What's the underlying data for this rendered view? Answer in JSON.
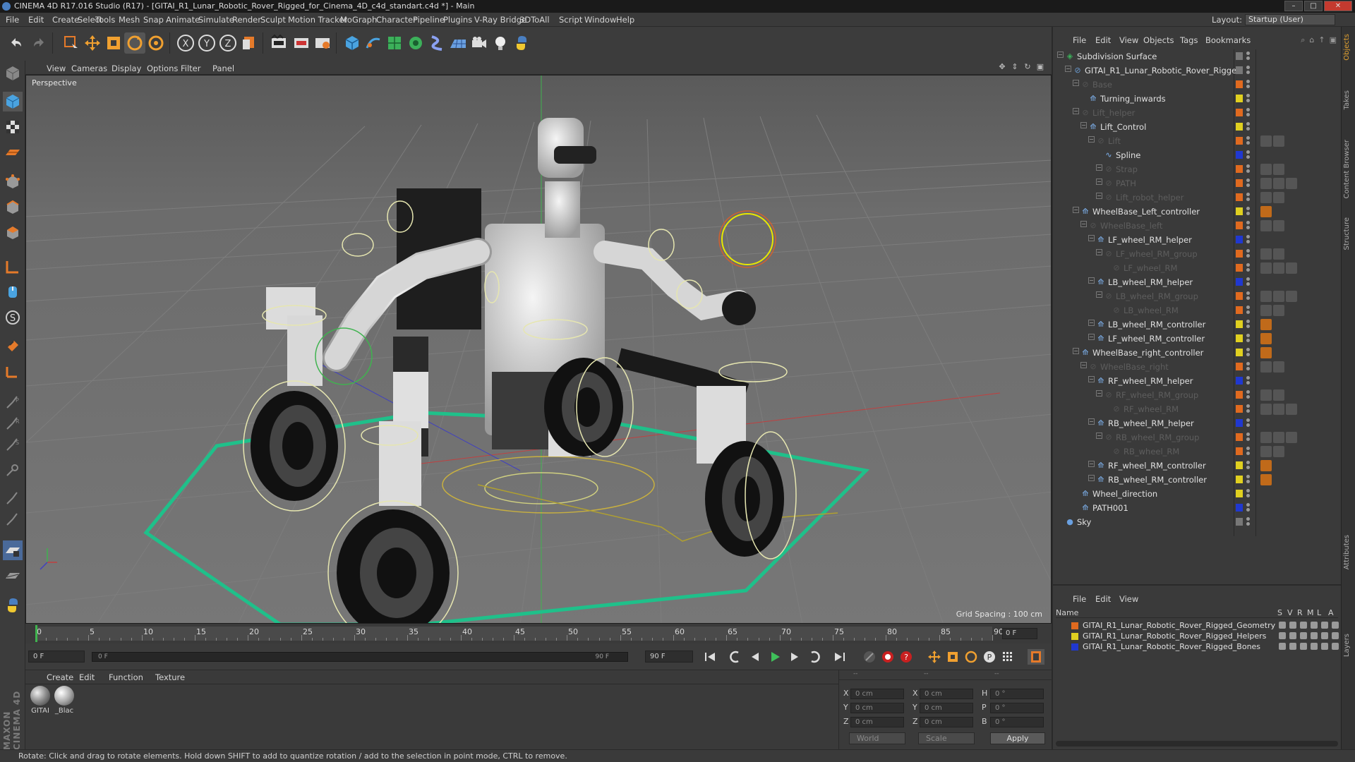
{
  "window": {
    "title": "CINEMA 4D R17.016 Studio (R17) - [GITAI_R1_Lunar_Robotic_Rover_Rigged_for_Cinema_4D_c4d_standart.c4d *] - Main"
  },
  "menu": [
    "File",
    "Edit",
    "Create",
    "Select",
    "Tools",
    "Mesh",
    "Snap",
    "Animate",
    "Simulate",
    "Render",
    "Sculpt",
    "Motion Tracker",
    "MoGraph",
    "Character",
    "Pipeline",
    "Plugins",
    "V-Ray Bridge",
    "3DToAll",
    "Script",
    "Window",
    "Help"
  ],
  "layout": {
    "label": "Layout:",
    "value": "Startup (User)"
  },
  "viewport": {
    "menu": [
      "View",
      "Cameras",
      "Display",
      "Options",
      "Filter",
      "Panel"
    ],
    "label": "Perspective",
    "grid_spacing": "Grid Spacing : 100 cm"
  },
  "timeline": {
    "ticks": [
      "0",
      "5",
      "10",
      "15",
      "20",
      "25",
      "30",
      "35",
      "40",
      "45",
      "50",
      "55",
      "60",
      "65",
      "70",
      "75",
      "80",
      "85",
      "90"
    ],
    "current_frame": "0 F",
    "start": "0 F",
    "slider_start": "0 F",
    "slider_end": "90 F",
    "end": "90 F"
  },
  "material_manager": {
    "menu": [
      "Create",
      "Edit",
      "Function",
      "Texture"
    ],
    "materials": [
      {
        "label": "GITAI",
        "color": "#9a9a9a"
      },
      {
        "label": "_Blac",
        "color": "#b0b0b0"
      }
    ]
  },
  "coords": {
    "header": [
      "--",
      "--",
      "--"
    ],
    "rows": [
      {
        "a": "X",
        "av": "0 cm",
        "b": "X",
        "bv": "0 cm",
        "c": "H",
        "cv": "0 °"
      },
      {
        "a": "Y",
        "av": "0 cm",
        "b": "Y",
        "bv": "0 cm",
        "c": "P",
        "cv": "0 °"
      },
      {
        "a": "Z",
        "av": "0 cm",
        "b": "Z",
        "bv": "0 cm",
        "c": "B",
        "cv": "0 °"
      }
    ],
    "world": "World",
    "scale": "Scale",
    "apply": "Apply"
  },
  "object_manager": {
    "menu": [
      "File",
      "Edit",
      "View",
      "Objects",
      "Tags",
      "Bookmarks"
    ],
    "objects": [
      {
        "name": "Subdivision Surface",
        "depth": 0,
        "dim": false,
        "tag": "#777",
        "icon": "subdivision-icon"
      },
      {
        "name": "GITAI_R1_Lunar_Robotic_Rover_Rigged",
        "depth": 1,
        "dim": false,
        "tag": "#777",
        "icon": "null-icon"
      },
      {
        "name": "Base",
        "depth": 2,
        "dim": true,
        "tag": "#e06a1f",
        "icon": "null-icon"
      },
      {
        "name": "Turning_inwards",
        "depth": 3,
        "dim": false,
        "tag": "#e0d020",
        "icon": "joint-icon"
      },
      {
        "name": "Lift_helper",
        "depth": 2,
        "dim": true,
        "tag": "#e06a1f",
        "icon": "null-icon"
      },
      {
        "name": "Lift_Control",
        "depth": 3,
        "dim": false,
        "tag": "#e0d020",
        "icon": "joint-icon"
      },
      {
        "name": "Lift",
        "depth": 4,
        "dim": true,
        "tag": "#e06a1f",
        "icon": "null-icon"
      },
      {
        "name": "Spline",
        "depth": 5,
        "dim": false,
        "tag": "#2038d0",
        "icon": "spline-icon"
      },
      {
        "name": "Strap",
        "depth": 5,
        "dim": true,
        "tag": "#e06a1f",
        "icon": "null-icon"
      },
      {
        "name": "PATH",
        "depth": 5,
        "dim": true,
        "tag": "#e06a1f",
        "icon": "null-icon"
      },
      {
        "name": "Lift_robot_helper",
        "depth": 5,
        "dim": true,
        "tag": "#e06a1f",
        "icon": "null-icon"
      },
      {
        "name": "WheelBase_Left_controller",
        "depth": 2,
        "dim": false,
        "tag": "#e0d020",
        "icon": "joint-icon"
      },
      {
        "name": "WheelBase_left",
        "depth": 3,
        "dim": true,
        "tag": "#e06a1f",
        "icon": "null-icon"
      },
      {
        "name": "LF_wheel_RM_helper",
        "depth": 4,
        "dim": false,
        "tag": "#2038d0",
        "icon": "joint-icon"
      },
      {
        "name": "LF_wheel_RM_group",
        "depth": 5,
        "dim": true,
        "tag": "#e06a1f",
        "icon": "null-icon"
      },
      {
        "name": "LF_wheel_RM",
        "depth": 6,
        "dim": true,
        "tag": "#e06a1f",
        "icon": "null-icon"
      },
      {
        "name": "LB_wheel_RM_helper",
        "depth": 4,
        "dim": false,
        "tag": "#2038d0",
        "icon": "joint-icon"
      },
      {
        "name": "LB_wheel_RM_group",
        "depth": 5,
        "dim": true,
        "tag": "#e06a1f",
        "icon": "null-icon"
      },
      {
        "name": "LB_wheel_RM",
        "depth": 6,
        "dim": true,
        "tag": "#e06a1f",
        "icon": "null-icon"
      },
      {
        "name": "LB_wheel_RM_controller",
        "depth": 4,
        "dim": false,
        "tag": "#e0d020",
        "icon": "joint-icon"
      },
      {
        "name": "LF_wheel_RM_controller",
        "depth": 4,
        "dim": false,
        "tag": "#e0d020",
        "icon": "joint-icon"
      },
      {
        "name": "WheelBase_right_controller",
        "depth": 2,
        "dim": false,
        "tag": "#e0d020",
        "icon": "joint-icon"
      },
      {
        "name": "WheelBase_right",
        "depth": 3,
        "dim": true,
        "tag": "#e06a1f",
        "icon": "null-icon"
      },
      {
        "name": "RF_wheel_RM_helper",
        "depth": 4,
        "dim": false,
        "tag": "#2038d0",
        "icon": "joint-icon"
      },
      {
        "name": "RF_wheel_RM_group",
        "depth": 5,
        "dim": true,
        "tag": "#e06a1f",
        "icon": "null-icon"
      },
      {
        "name": "RF_wheel_RM",
        "depth": 6,
        "dim": true,
        "tag": "#e06a1f",
        "icon": "null-icon"
      },
      {
        "name": "RB_wheel_RM_helper",
        "depth": 4,
        "dim": false,
        "tag": "#2038d0",
        "icon": "joint-icon"
      },
      {
        "name": "RB_wheel_RM_group",
        "depth": 5,
        "dim": true,
        "tag": "#e06a1f",
        "icon": "null-icon"
      },
      {
        "name": "RB_wheel_RM",
        "depth": 6,
        "dim": true,
        "tag": "#e06a1f",
        "icon": "null-icon"
      },
      {
        "name": "RF_wheel_RM_controller",
        "depth": 4,
        "dim": false,
        "tag": "#e0d020",
        "icon": "joint-icon"
      },
      {
        "name": "RB_wheel_RM_controller",
        "depth": 4,
        "dim": false,
        "tag": "#e0d020",
        "icon": "joint-icon"
      },
      {
        "name": "Wheel_direction",
        "depth": 2,
        "dim": false,
        "tag": "#e0d020",
        "icon": "joint-icon"
      },
      {
        "name": "PATH001",
        "depth": 2,
        "dim": false,
        "tag": "#2038d0",
        "icon": "joint-icon"
      },
      {
        "name": "Sky",
        "depth": 0,
        "dim": false,
        "tag": "#777",
        "icon": "sky-icon"
      }
    ]
  },
  "layer_manager": {
    "menu": [
      "File",
      "Edit",
      "View"
    ],
    "headers": [
      "Name",
      "S",
      "V",
      "R",
      "M",
      "L",
      "A"
    ],
    "layers": [
      {
        "name": "GITAI_R1_Lunar_Robotic_Rover_Rigged_Geometry",
        "color": "#e06a1f"
      },
      {
        "name": "GITAI_R1_Lunar_Robotic_Rover_Rigged_Helpers",
        "color": "#e0d020"
      },
      {
        "name": "GITAI_R1_Lunar_Robotic_Rover_Rigged_Bones",
        "color": "#2038d0"
      }
    ]
  },
  "side_tabs": [
    "Objects",
    "Takes",
    "Content Browser",
    "Structure",
    "Attributes",
    "Layers"
  ],
  "status": "Rotate: Click and drag to rotate elements. Hold down SHIFT to add to quantize rotation / add to the selection in point mode, CTRL to remove.",
  "brand": "MAXON CINEMA 4D"
}
